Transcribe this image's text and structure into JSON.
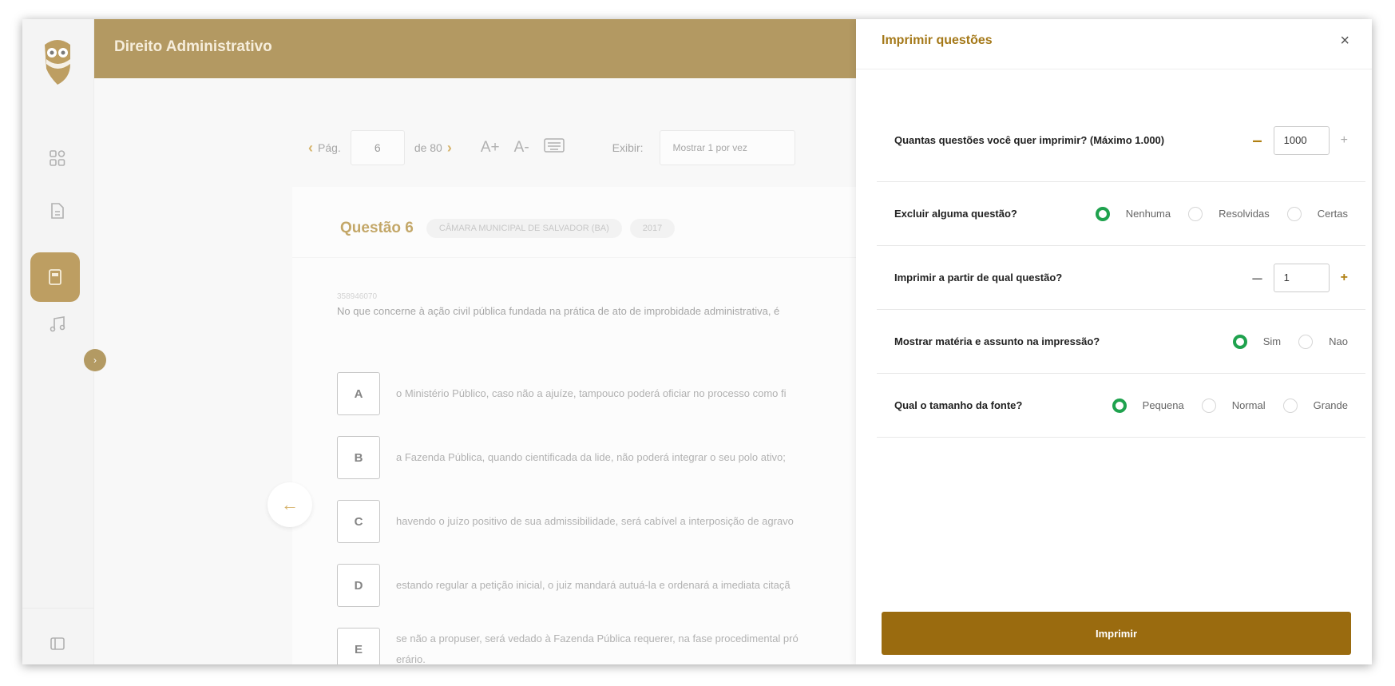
{
  "header": {
    "title": "Direito Administrativo"
  },
  "pager": {
    "label": "Pág.",
    "current": "6",
    "of_label": "de 80",
    "font_up": "A+",
    "font_down": "A-",
    "exibir_label": "Exibir:",
    "exibir_value": "Mostrar 1 por vez"
  },
  "question": {
    "title": "Questão 6",
    "tags": [
      "CÂMARA MUNICIPAL DE SALVADOR (BA)",
      "2017"
    ],
    "code": "358946070",
    "text": "No que concerne à ação civil pública fundada na prática de ato de improbidade administrativa, é",
    "alternatives": [
      {
        "letter": "A",
        "text": "o Ministério Público, caso não a ajuíze, tampouco poderá oficiar no processo como fi"
      },
      {
        "letter": "B",
        "text": "a Fazenda Pública, quando cientificada da lide, não poderá integrar o seu polo ativo;"
      },
      {
        "letter": "C",
        "text": "havendo o juízo positivo de sua admissibilidade, será cabível a interposição de agravo"
      },
      {
        "letter": "D",
        "text": "estando regular a petição inicial, o juiz mandará autuá-la e ordenará a imediata citaçã"
      },
      {
        "letter": "E",
        "text": "se não a propuser, será vedado à Fazenda Pública requerer, na fase procedimental pró",
        "text2": "erário."
      }
    ]
  },
  "modal": {
    "title": "Imprimir questões",
    "close": "×",
    "quantity": {
      "label": "Quantas questões você quer imprimir? (Máximo 1.000)",
      "value": "1000",
      "minus": "–",
      "plus": "+"
    },
    "exclude": {
      "label": "Excluir alguma questão?",
      "options": [
        "Nenhuma",
        "Resolvidas",
        "Certas"
      ],
      "selected": "Nenhuma"
    },
    "start": {
      "label": "Imprimir a partir de qual questão?",
      "value": "1",
      "minus": "–",
      "plus": "+"
    },
    "show_subject": {
      "label": "Mostrar matéria e assunto na impressão?",
      "options": [
        "Sim",
        "Nao"
      ],
      "selected": "Sim"
    },
    "font_size": {
      "label": "Qual o tamanho da fonte?",
      "options": [
        "Pequena",
        "Normal",
        "Grande"
      ],
      "selected": "Pequena"
    },
    "print_button": "Imprimir"
  },
  "colors": {
    "brand": "#8b630f",
    "accent": "#a47818",
    "radio_checked": "#1fa24e"
  }
}
